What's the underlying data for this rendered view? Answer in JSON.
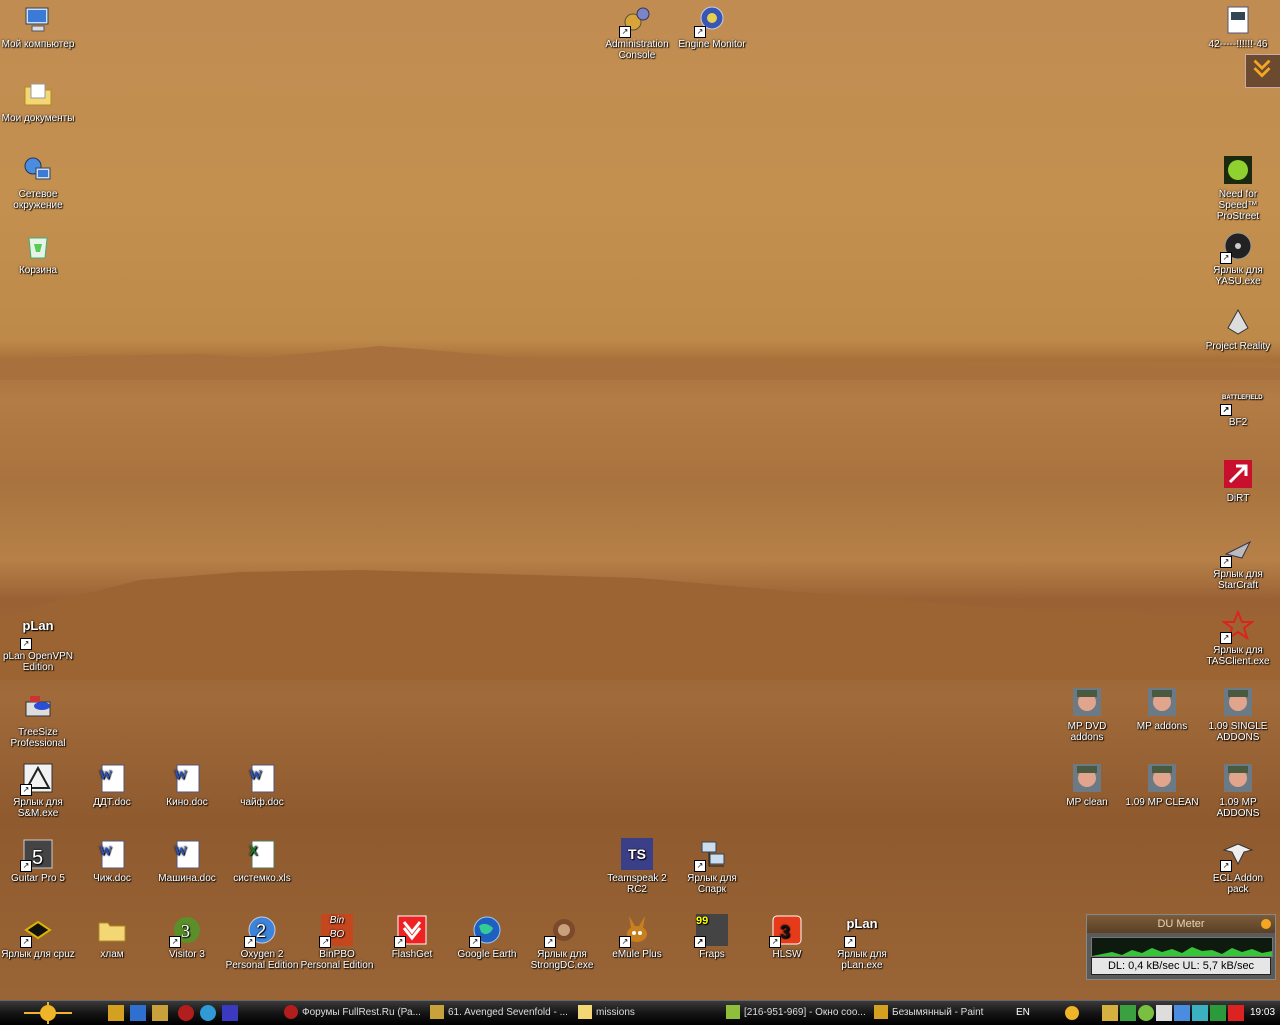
{
  "desktop_icons": {
    "my_computer": "Мой компьютер",
    "my_documents": "Мои документы",
    "network": "Сетевое окружение",
    "recycle": "Корзина",
    "admin_console": "Administration Console",
    "engine_monitor": "Engine Monitor",
    "file_42": "42-----!!!!!!-46",
    "nfs": "Need for Speed™ ProStreet",
    "yasu": "Ярлык для YASU.exe",
    "project_reality": "Project Reality",
    "bf2": "BF2",
    "dirt": "DiRT",
    "starcraft": "Ярлык для StarCraft",
    "tasclient": "Ярлык для TASClient.exe",
    "plan_vpn": "pLan OpenVPN Edition",
    "treesize": "TreeSize Professional",
    "sm": "Ярлык для S&M.exe",
    "ddt": "ДДТ.doc",
    "kino": "Кино.doc",
    "chaif": "чайф.doc",
    "guitar": "Guitar Pro 5",
    "chizh": "Чиж.doc",
    "mashina": "Машина.doc",
    "sistemko": "системко.xls",
    "teamspeak": "Teamspeak 2 RC2",
    "spark": "Ярлык для Спарк",
    "cpuz": "Ярлык для cpuz",
    "hlam": "хлам",
    "visitor": "Visitor 3",
    "oxygen": "Oxygen 2 Personal Edition",
    "binpbo": "BinPBO Personal Edition",
    "flashget": "FlashGet",
    "gearth": "Google Earth",
    "strongdc": "Ярлык для StrongDC.exe",
    "emule": "eMule Plus",
    "fraps": "Fraps",
    "hlsw": "HLSW",
    "plan": "Ярлык для pLan.exe",
    "mp_dvd": "MP DVD addons",
    "mp_addons": "MP addons",
    "single": "1.09 SINGLE ADDONS",
    "mp_clean": "MP clean",
    "mp_clean2": "1.09 MP CLEAN",
    "mp_addons2": "1.09 MP ADDONS",
    "ecl": "ECL Addon pack",
    "plan_logo": "pLan",
    "bin_logo": "Bin",
    "bo_logo": "BO",
    "ts_logo": "TS",
    "fraps_logo": "99",
    "bf2_logo": "BATTLEFIELD"
  },
  "du_meter": {
    "title": "DU Meter",
    "reading": "DL: 0,4 kB/sec  UL: 5,7 kB/sec"
  },
  "taskbar": {
    "tasks": [
      {
        "label": "Форумы FullRest.Ru (Ра..."
      },
      {
        "label": "61. Avenged Sevenfold - ..."
      },
      {
        "label": "missions"
      },
      {
        "label": "[216-951-969] - Окно соо..."
      },
      {
        "label": "Безымянный - Paint"
      }
    ],
    "lang": "EN",
    "clock": "19:03"
  },
  "colors": {
    "sky": "#c08c52",
    "taskbar": "#151515"
  }
}
